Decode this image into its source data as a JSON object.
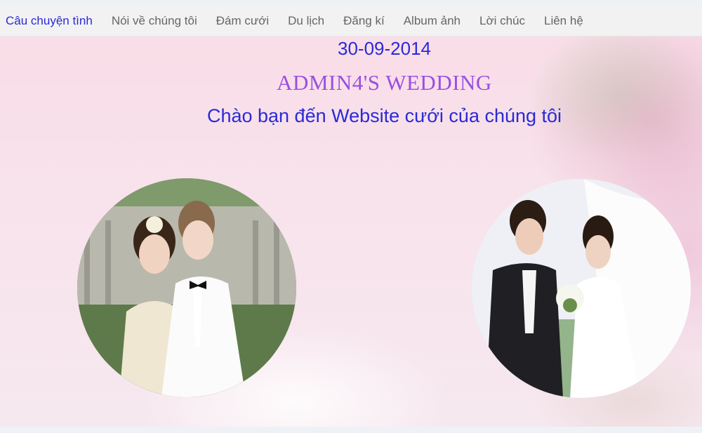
{
  "nav": {
    "items": [
      {
        "label": "Câu chuyện tình"
      },
      {
        "label": "Nói về chúng tôi"
      },
      {
        "label": "Đám cưới"
      },
      {
        "label": "Du lịch"
      },
      {
        "label": "Đăng kí"
      },
      {
        "label": "Album ảnh"
      },
      {
        "label": "Lời chúc"
      },
      {
        "label": "Liên hệ"
      }
    ],
    "active_index": 0
  },
  "hero": {
    "date": "30-09-2014",
    "title": "ADMIN4'S WEDDING",
    "welcome": "Chào bạn đến Website cưới của chúng tôi"
  },
  "colors": {
    "link_active": "#2a2ad6",
    "title_purple": "#9a4fe0",
    "nav_text": "#666666",
    "nav_bg": "#f2f2f2"
  }
}
